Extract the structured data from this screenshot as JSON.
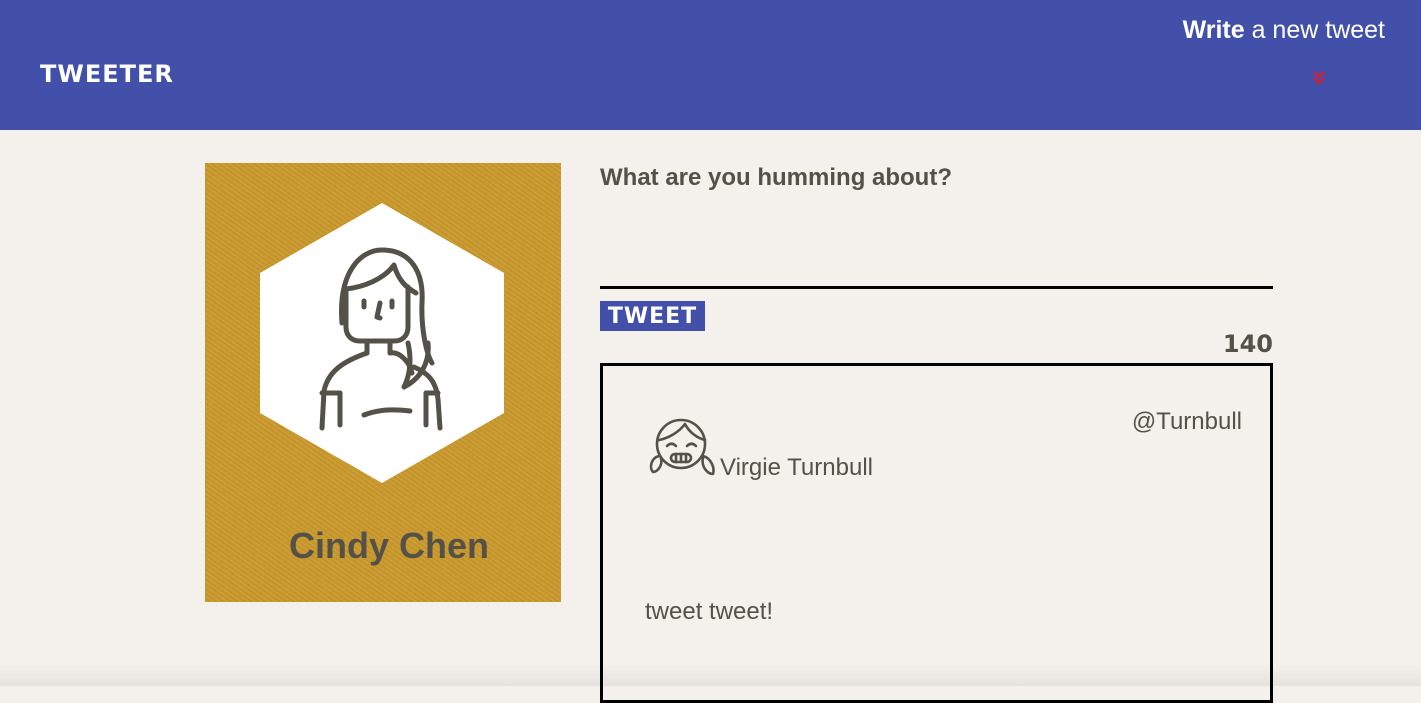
{
  "nav": {
    "brand": "TWEETER",
    "compose_bold": "Write",
    "compose_rest": " a new tweet",
    "chevron_icon": "double-chevron-down-icon",
    "chevron_color": "#d11f3a",
    "background": "#4350aa"
  },
  "profile": {
    "name": "Cindy Chen",
    "avatar_icon": "woman-avatar-icon",
    "card_color": "#c9992c"
  },
  "composer": {
    "label": "What are you humming about?",
    "input_value": "",
    "button_label": "TWEET",
    "counter": "140"
  },
  "tweets": [
    {
      "author": "Virgie Turnbull",
      "handle": "@Turnbull",
      "body": "tweet tweet!",
      "avatar_icon": "girl-avatar-icon"
    }
  ]
}
